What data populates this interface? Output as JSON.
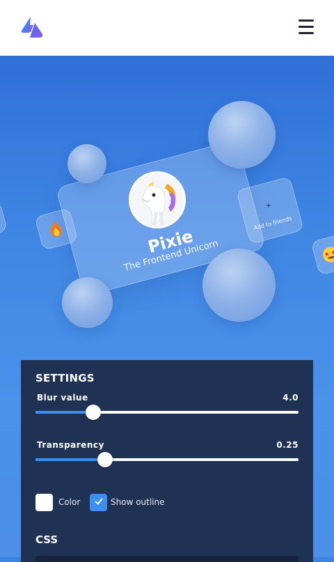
{
  "header": {
    "logo_icon": "bolt-logo-icon",
    "menu_icon": "hamburger-menu-icon"
  },
  "preview": {
    "name": "Pixie",
    "subtitle": "The Frontend Unicorn",
    "add_friend_label": "Add to friends",
    "add_friend_icon": "+",
    "emoji_left_icon": "fire-icon",
    "emoji_right_icon": "star-struck-icon",
    "avatar_icon": "unicorn-avatar-icon"
  },
  "settings": {
    "title": "SETTINGS",
    "blur": {
      "label": "Blur value",
      "value": "4.0",
      "fraction": 0.22
    },
    "transparency": {
      "label": "Transparency",
      "value": "0.25",
      "fraction": 0.265
    },
    "color_checkbox": {
      "label": "Color",
      "checked": false
    },
    "outline_checkbox": {
      "label": "Show outline",
      "checked": true
    },
    "css_title": "CSS"
  },
  "colors": {
    "accent": "#3d8ef3",
    "panel": "#1f3253",
    "background": "#3d83df"
  }
}
